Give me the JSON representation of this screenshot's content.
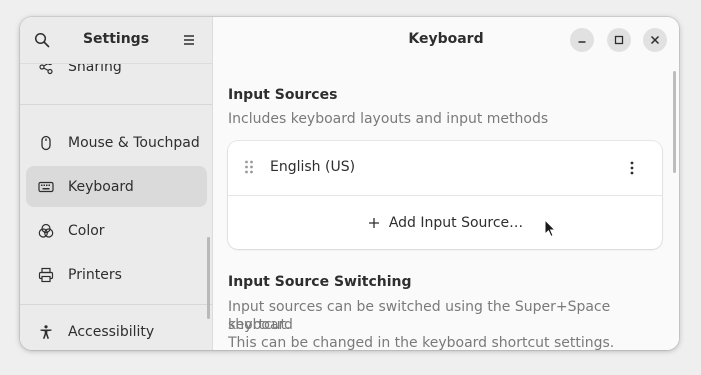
{
  "sidebar": {
    "title": "Settings",
    "items": [
      {
        "label": "Sharing",
        "icon": "share-icon"
      },
      {
        "label": "Mouse & Touchpad",
        "icon": "mouse-icon"
      },
      {
        "label": "Keyboard",
        "icon": "keyboard-icon",
        "selected": true
      },
      {
        "label": "Color",
        "icon": "color-icon"
      },
      {
        "label": "Printers",
        "icon": "printer-icon"
      },
      {
        "label": "Accessibility",
        "icon": "accessibility-icon"
      }
    ]
  },
  "main": {
    "title": "Keyboard",
    "input_sources": {
      "title": "Input Sources",
      "subtitle": "Includes keyboard layouts and input methods",
      "sources": [
        {
          "label": "English (US)"
        }
      ],
      "add_label": "Add Input Source…"
    },
    "switching": {
      "title": "Input Source Switching",
      "line1": "Input sources can be switched using the Super+Space keyboard",
      "line2": "shortcut.",
      "line3": "This can be changed in the keyboard shortcut settings."
    }
  },
  "colors": {
    "sidebar_bg": "#ebebeb",
    "selected_bg": "#dadada",
    "content_bg": "#fafafa",
    "card_bg": "#ffffff",
    "text": "#2e2e2e",
    "dim_text": "#7a7a7a"
  }
}
